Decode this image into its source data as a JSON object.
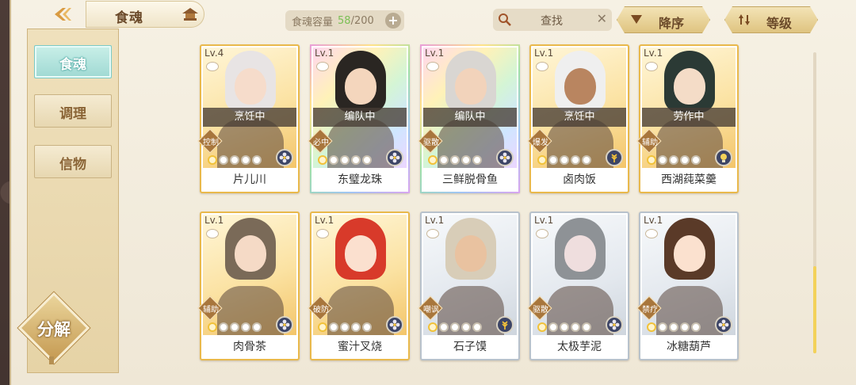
{
  "header": {
    "title": "食魂",
    "capacity_label": "食魂容量",
    "capacity_current": "58",
    "capacity_max": "/200",
    "capacity_plus": "+",
    "search_placeholder": "查找",
    "search_clear": "✕",
    "sort_order_label": "降序",
    "sort_field_label": "等级"
  },
  "sidebar": {
    "tabs": [
      {
        "label": "食魂",
        "active": true
      },
      {
        "label": "调理",
        "active": false
      },
      {
        "label": "信物",
        "active": false
      }
    ],
    "decompose_label": "分解"
  },
  "cards": [
    {
      "level": "Lv.4",
      "name": "片儿川",
      "status": "烹饪中",
      "role": "控制",
      "rarity": "gold",
      "stars": 0,
      "element": "flower",
      "hair": "#e8e4e4",
      "skin": "#f6dccb"
    },
    {
      "level": "Lv.1",
      "name": "东璧龙珠",
      "status": "编队中",
      "role": "必中",
      "rarity": "rainbow",
      "stars": 0,
      "element": "flower",
      "hair": "#2a2622",
      "skin": "#f4d6bd"
    },
    {
      "level": "Lv.1",
      "name": "三鲜脱骨鱼",
      "status": "编队中",
      "role": "驱散",
      "rarity": "rainbow",
      "stars": 0,
      "element": "flower",
      "hair": "#d9d6d2",
      "skin": "#f2d3bb"
    },
    {
      "level": "Lv.1",
      "name": "卤肉饭",
      "status": "烹饪中",
      "role": "爆发",
      "rarity": "gold",
      "stars": 0,
      "element": "wheat",
      "hair": "#efefef",
      "skin": "#b98560"
    },
    {
      "level": "Lv.1",
      "name": "西湖莼菜羹",
      "status": "劳作中",
      "role": "辅助",
      "rarity": "gold",
      "stars": 0,
      "element": "bulb",
      "hair": "#2b3a35",
      "skin": "#f4dcc7"
    },
    {
      "level": "Lv.1",
      "name": "肉骨茶",
      "status": "",
      "role": "辅助",
      "rarity": "gold",
      "stars": 0,
      "element": "flower",
      "hair": "#7a6a58",
      "skin": "#f5dac6"
    },
    {
      "level": "Lv.1",
      "name": "蜜汁叉烧",
      "status": "",
      "role": "破防",
      "rarity": "gold",
      "stars": 0,
      "element": "flower",
      "hair": "#d83a2a",
      "skin": "#fbe0cf"
    },
    {
      "level": "Lv.1",
      "name": "石子馍",
      "status": "",
      "role": "嘲讽",
      "rarity": "silver",
      "stars": 0,
      "element": "wheat",
      "hair": "#d8cdb8",
      "skin": "#e9c2a0"
    },
    {
      "level": "Lv.1",
      "name": "太极芋泥",
      "status": "",
      "role": "驱散",
      "rarity": "silver",
      "stars": 0,
      "element": "flower",
      "hair": "#8e9296",
      "skin": "#efdede"
    },
    {
      "level": "Lv.1",
      "name": "冰糖葫芦",
      "status": "",
      "role": "禁疗",
      "rarity": "silver",
      "stars": 0,
      "element": "flower",
      "hair": "#5a3a28",
      "skin": "#fbe1cf"
    }
  ],
  "colors": {
    "accent_teal": "#9fd9d3",
    "gold_frame": "#e9b94c",
    "capacity_current": "#7bbf55"
  }
}
